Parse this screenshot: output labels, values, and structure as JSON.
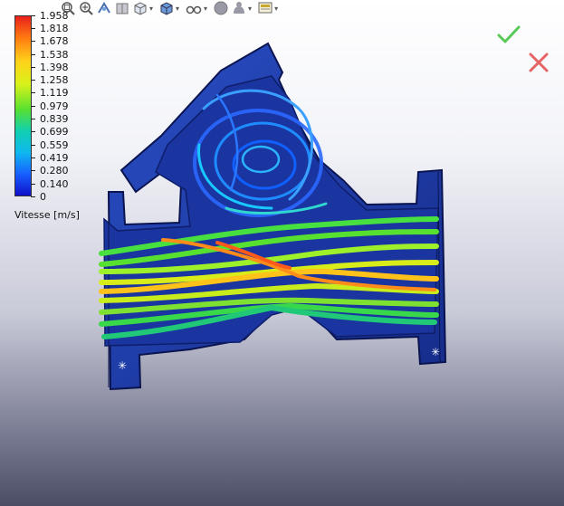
{
  "legend": {
    "title": "Vitesse [m/s]",
    "ticks": [
      "1.958",
      "1.818",
      "1.678",
      "1.538",
      "1.398",
      "1.258",
      "1.119",
      "0.979",
      "0.839",
      "0.699",
      "0.559",
      "0.419",
      "0.280",
      "0.140",
      "0"
    ],
    "colors": {
      "max": "#e8201c",
      "mid": "#58e030",
      "min": "#1010c8"
    }
  },
  "toolbar": {
    "icons": [
      "zoom-to-fit-icon",
      "zoom-area-icon",
      "previous-view-icon",
      "section-view-icon",
      "view-orientation-icon",
      "display-style-icon",
      "hide-show-items-icon",
      "edit-appearance-icon",
      "apply-scene-icon",
      "view-settings-icon"
    ]
  },
  "confirm": {
    "ok_icon": "checkmark-icon",
    "cancel_icon": "close-icon",
    "ok_color": "#3cc03c",
    "cancel_color": "#e04040"
  },
  "model": {
    "part_color": "#1f3aa8",
    "edge_color": "#0a1450"
  }
}
